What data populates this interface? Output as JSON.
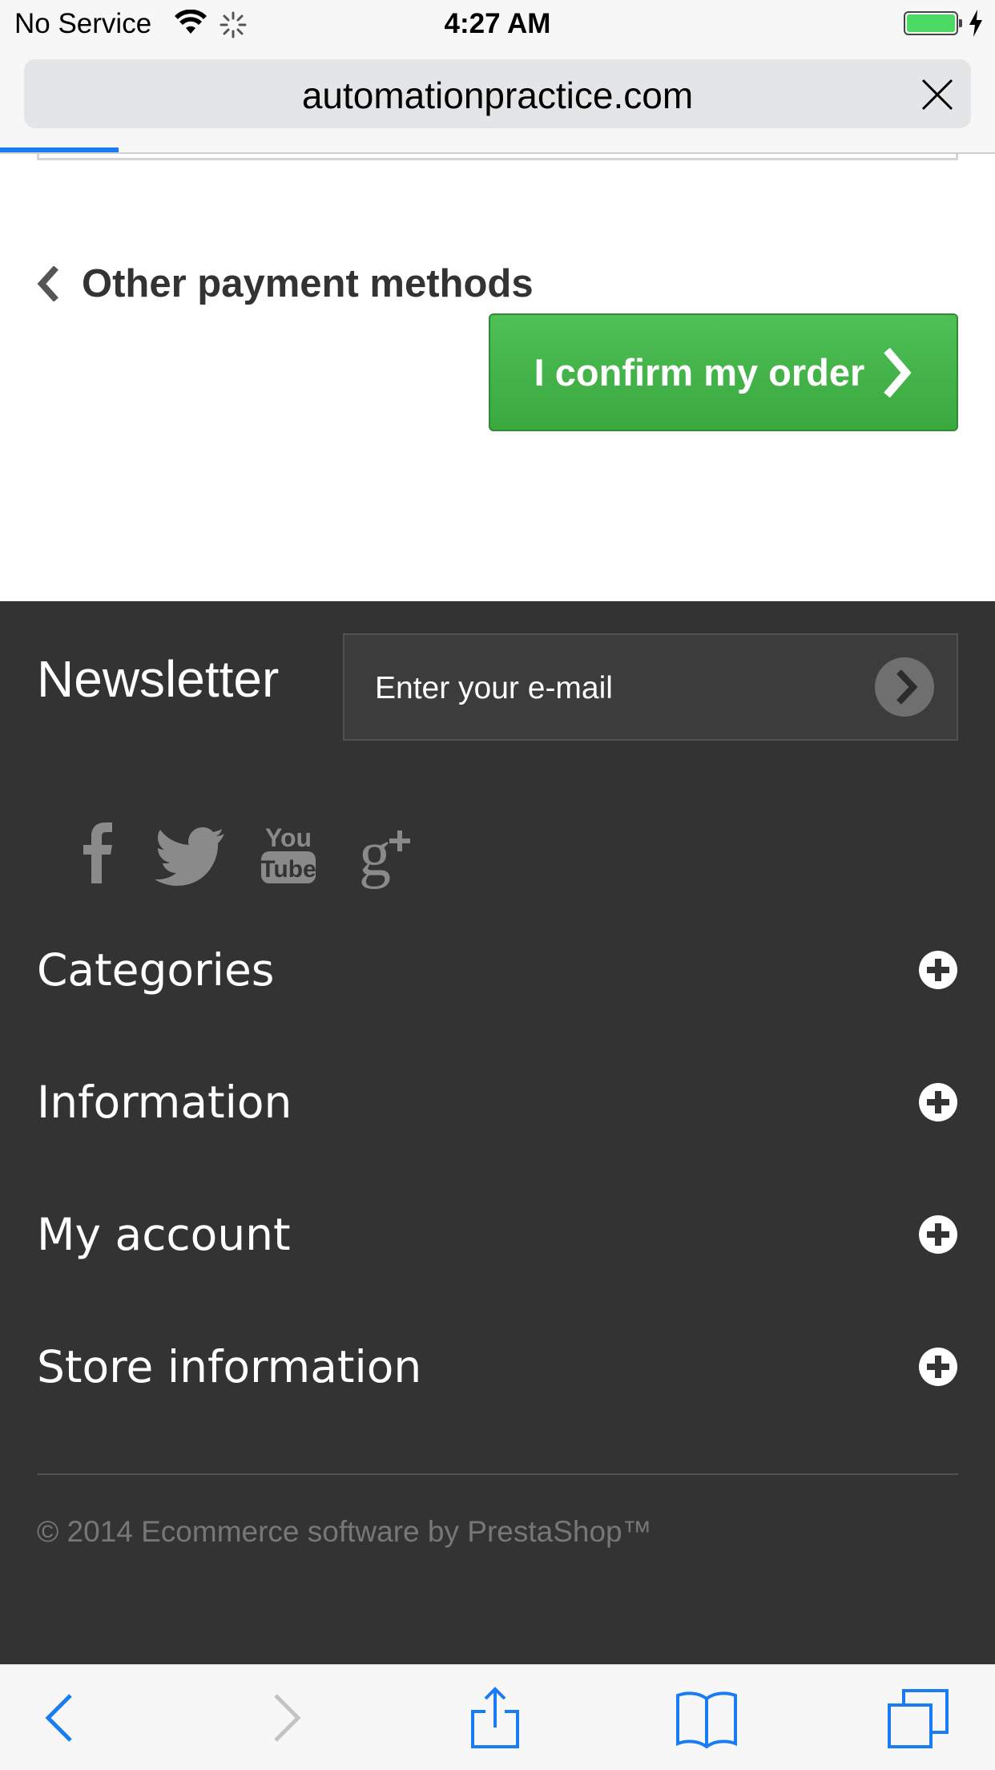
{
  "status": {
    "carrier": "No Service",
    "time": "4:27 AM",
    "battery_color": "#4cd964"
  },
  "browser": {
    "url": "automationpractice.com",
    "accent": "#1a7cf5"
  },
  "payment": {
    "other_methods_label": "Other payment methods",
    "confirm_button_label": "I confirm my order",
    "confirm_color": "#3aa83f"
  },
  "footer": {
    "background": "#333333",
    "newsletter_title": "Newsletter",
    "newsletter_placeholder": "Enter your e-mail",
    "social_icons": [
      "facebook-icon",
      "twitter-icon",
      "youtube-icon",
      "google-plus-icon"
    ],
    "sections": [
      {
        "label": "Categories"
      },
      {
        "label": "Information"
      },
      {
        "label": "My account"
      },
      {
        "label": "Store information"
      }
    ],
    "copyright": "© 2014 Ecommerce software by PrestaShop™"
  },
  "toolbar": {
    "icons": [
      "back-icon",
      "forward-icon",
      "share-icon",
      "bookmarks-icon",
      "tabs-icon"
    ]
  }
}
